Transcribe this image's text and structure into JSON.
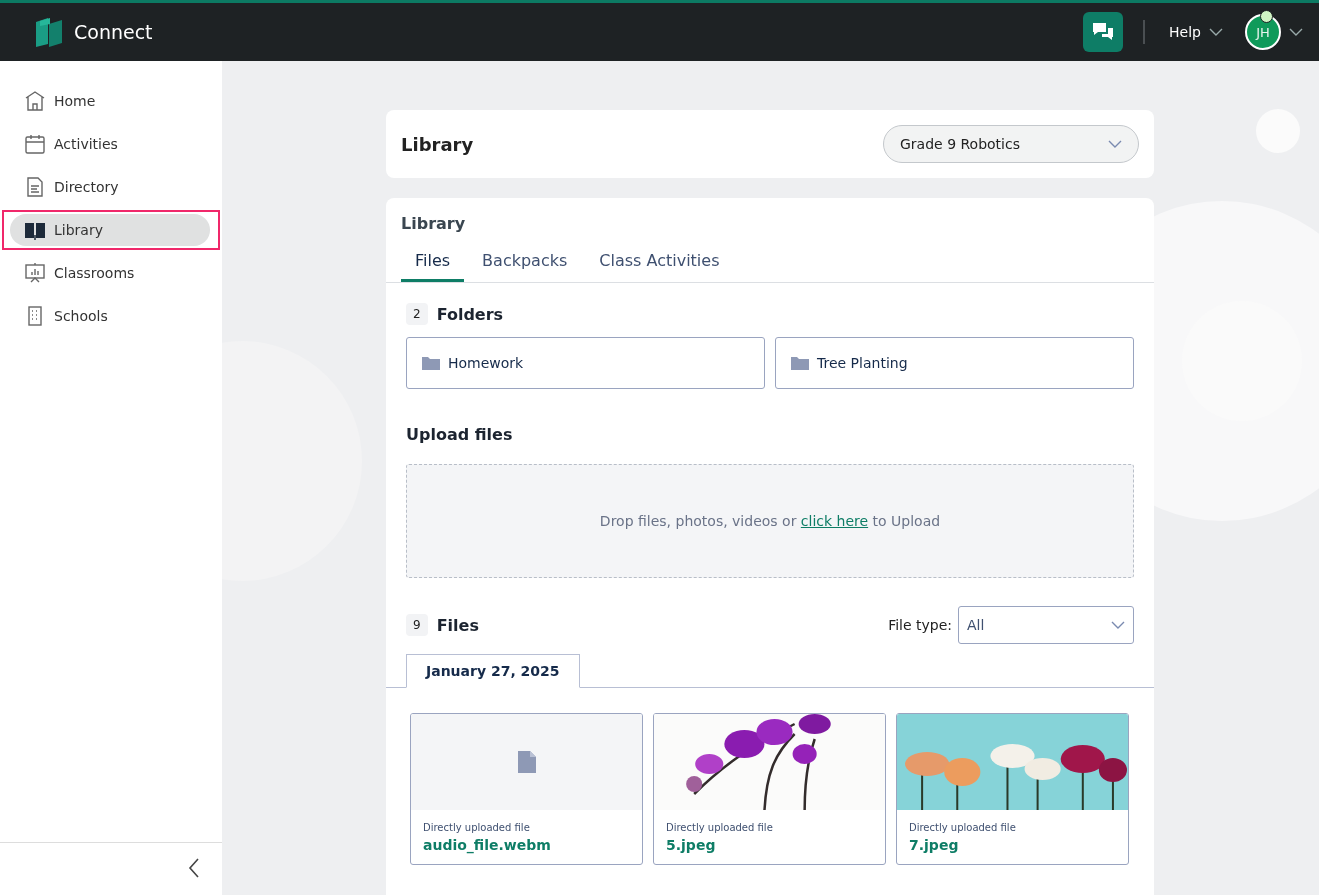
{
  "app": {
    "name": "Connect"
  },
  "header": {
    "help": "Help",
    "avatar": {
      "initials": "JH",
      "online": true
    }
  },
  "sidebar": {
    "items": [
      {
        "label": "Home",
        "selected": false,
        "highlighted": false
      },
      {
        "label": "Activities",
        "selected": false,
        "highlighted": false
      },
      {
        "label": "Directory",
        "selected": false,
        "highlighted": false
      },
      {
        "label": "Library",
        "selected": true,
        "highlighted": true
      },
      {
        "label": "Classrooms",
        "selected": false,
        "highlighted": false
      },
      {
        "label": "Schools",
        "selected": false,
        "highlighted": false
      }
    ]
  },
  "page": {
    "title": "Library",
    "class_select": {
      "value": "Grade 9 Robotics"
    }
  },
  "library": {
    "title": "Library",
    "tabs": [
      {
        "label": "Files",
        "selected": true
      },
      {
        "label": "Backpacks",
        "selected": false
      },
      {
        "label": "Class Activities",
        "selected": false
      }
    ],
    "folders": {
      "count": "2",
      "title": "Folders",
      "items": [
        {
          "name": "Homework"
        },
        {
          "name": "Tree Planting"
        }
      ]
    },
    "upload": {
      "title": "Upload files",
      "before": "Drop files, photos, videos or",
      "link": "click here",
      "after": "to Upload"
    },
    "files": {
      "count": "9",
      "title": "Files",
      "filter_label": "File type:",
      "filter_value": "All",
      "date_tab": "January 27, 2025",
      "items": [
        {
          "kind": "document",
          "caption": "Directly uploaded file",
          "name": "audio_file.webm"
        },
        {
          "kind": "picture",
          "caption": "Directly uploaded file",
          "name": "5.jpeg"
        },
        {
          "kind": "picture",
          "caption": "Directly uploaded file",
          "name": "7.jpeg"
        }
      ]
    }
  }
}
